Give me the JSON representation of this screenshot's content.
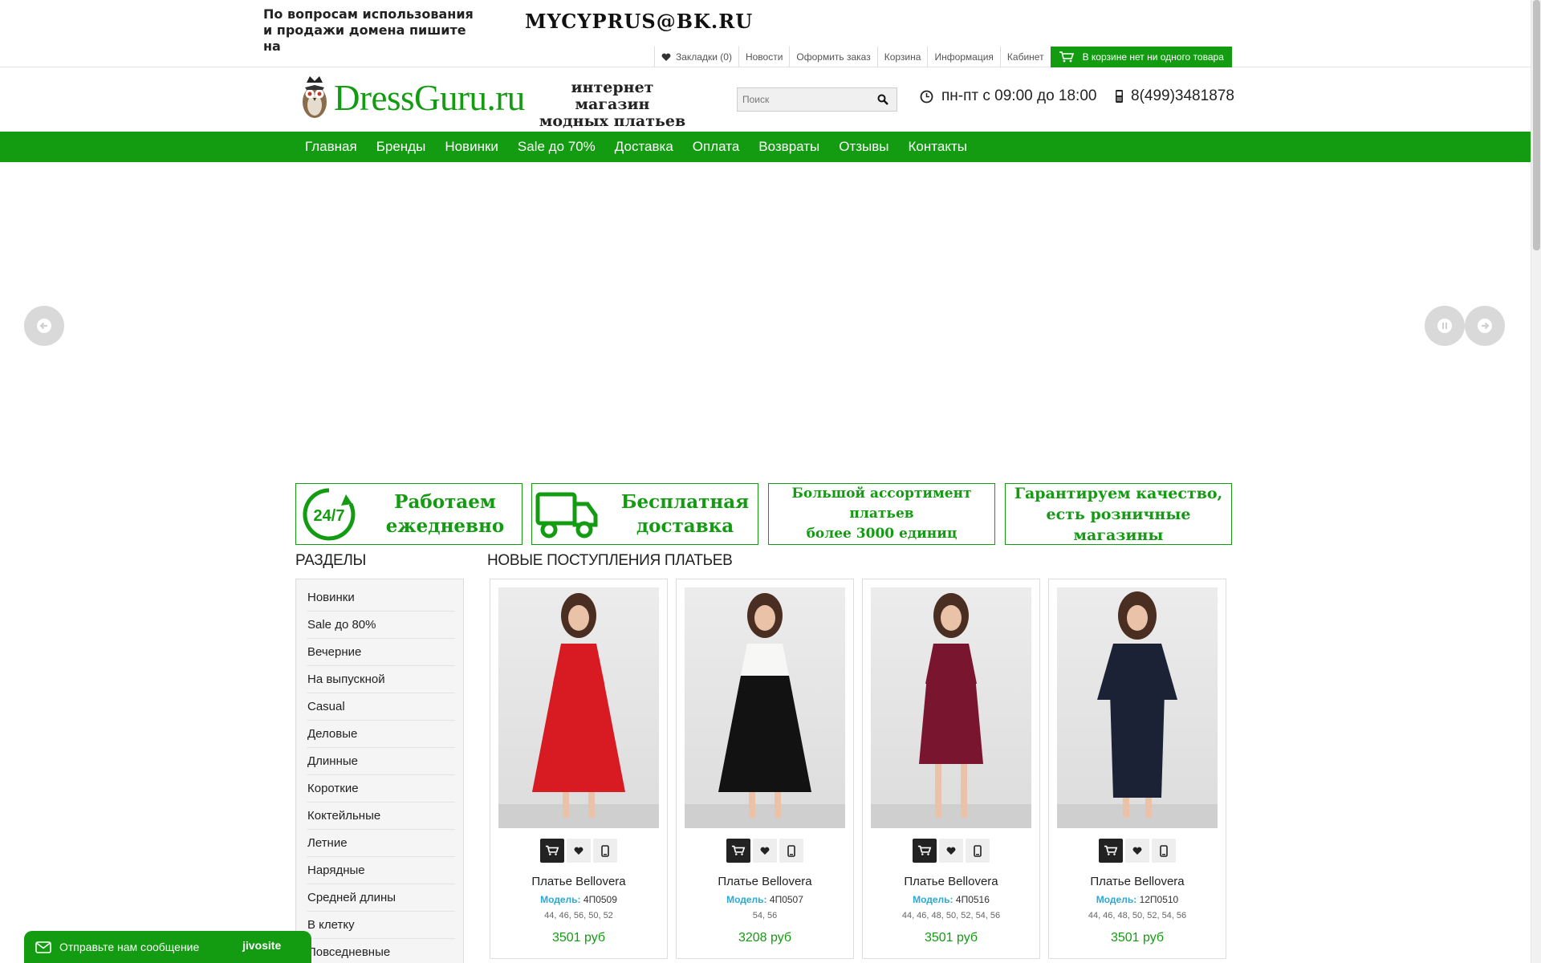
{
  "notice": {
    "text": "По вопросам использования и продажи домена пишите на",
    "email": "MYCYPRUS@BK.RU"
  },
  "toplinks": {
    "bookmarks": "Закладки (0)",
    "news": "Новости",
    "checkout": "Оформить заказ",
    "cart": "Корзина",
    "info": "Информация",
    "account": "Кабинет",
    "cart_status": "В корзине нет ни одного товара"
  },
  "header": {
    "logo": "DressGuru.ru",
    "tagline_1": "интернет магазин",
    "tagline_2": "модных платьев",
    "search_placeholder": "Поиск",
    "hours": "пн-пт с 09:00 до 18:00",
    "phone": "8(499)3481878"
  },
  "nav": [
    "Главная",
    "Бренды",
    "Новинки",
    "Sale до 70%",
    "Доставка",
    "Оплата",
    "Возвраты",
    "Отзывы",
    "Контакты"
  ],
  "banners": [
    {
      "badge": "24/7",
      "line1": "Работаем",
      "line2": "ежедневно"
    },
    {
      "line1": "Бесплатная",
      "line2": "доставка"
    },
    {
      "line1": "Большой ассортимент платьев",
      "line2": "более 3000 единиц"
    },
    {
      "line1": "Гарантируем качество,",
      "line2": "есть розничные магазины"
    }
  ],
  "sidebar": {
    "title": "РАЗДЕЛЫ",
    "items": [
      "Новинки",
      "Sale до 80%",
      "Вечерние",
      "На выпускной",
      "Casual",
      "Деловые",
      "Длинные",
      "Короткие",
      "Коктейльные",
      "Летние",
      "Нарядные",
      "Средней длины",
      "В клетку",
      "Повседневные"
    ]
  },
  "main": {
    "title": "НОВЫЕ ПОСТУПЛЕНИЯ ПЛАТЬЕВ",
    "model_label": "Модель:",
    "products": [
      {
        "name": "Платье Bellovera",
        "model": "4П0509",
        "sizes": "44, 46, 56, 50, 52",
        "price": "3501 руб",
        "dress_color": "#d81a22",
        "top_color": "#d81a22"
      },
      {
        "name": "Платье Bellovera",
        "model": "4П0507",
        "sizes": "54, 56",
        "price": "3208 руб",
        "dress_color": "#121212",
        "top_color": "#f7f7f5"
      },
      {
        "name": "Платье Bellovera",
        "model": "4П0516",
        "sizes": "44, 46, 48, 50, 52, 54, 56",
        "price": "3501 руб",
        "dress_color": "#7a1530",
        "top_color": "#7a1530"
      },
      {
        "name": "Платье Bellovera",
        "model": "12П0510",
        "sizes": "44, 46, 48, 50, 52, 54, 56",
        "price": "3501 руб",
        "dress_color": "#1b2235",
        "top_color": "#1b2235"
      }
    ]
  },
  "chat": {
    "text": "Отправьте нам сообщение",
    "brand": "jivosite"
  },
  "colors": {
    "accent": "#139b12",
    "link_blue": "#2aa9d4"
  }
}
